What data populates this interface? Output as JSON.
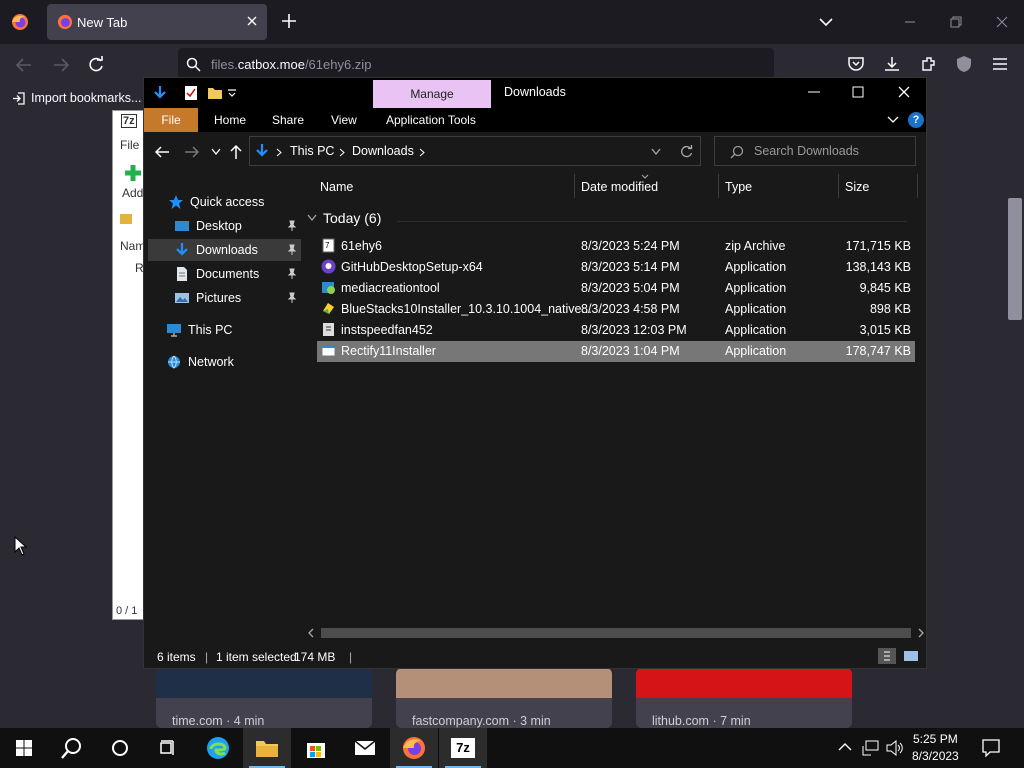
{
  "firefox": {
    "tab_title": "New Tab",
    "url_prefix": "files.",
    "url_domain": "catbox.moe",
    "url_path": "/61ehy6.zip",
    "bookmarks_import": "Import bookmarks...",
    "cards": [
      {
        "caption": "time.com · 4 min",
        "color": "#1f2f47"
      },
      {
        "caption": "fastcompany.com · 3 min",
        "color": "#b59078"
      },
      {
        "caption": "lithub.com · 7 min",
        "color": "#d51418"
      }
    ]
  },
  "sevenzip": {
    "logo": "7z",
    "menu_file": "File",
    "add": "Add",
    "col_name": "Nam",
    "row_fragment": "R",
    "status": "0 / 1"
  },
  "explorer": {
    "context_tab": "Manage",
    "title": "Downloads",
    "ribbon": {
      "file": "File",
      "home": "Home",
      "share": "Share",
      "view": "View",
      "app_tools": "Application Tools"
    },
    "help": "?",
    "breadcrumb": {
      "this_pc": "This PC",
      "downloads": "Downloads"
    },
    "search_placeholder": "Search Downloads",
    "nav": {
      "quick_access": "Quick access",
      "desktop": "Desktop",
      "downloads": "Downloads",
      "documents": "Documents",
      "pictures": "Pictures",
      "this_pc": "This PC",
      "network": "Network"
    },
    "columns": {
      "name": "Name",
      "date": "Date modified",
      "type": "Type",
      "size": "Size"
    },
    "group": "Today (6)",
    "files": [
      {
        "name": "61ehy6",
        "date": "8/3/2023 5:24 PM",
        "type": "zip Archive",
        "size": "171,715 KB",
        "icon": "zip-archive-icon",
        "selected": false
      },
      {
        "name": "GitHubDesktopSetup-x64",
        "date": "8/3/2023 5:14 PM",
        "type": "Application",
        "size": "138,143 KB",
        "icon": "github-icon",
        "selected": false
      },
      {
        "name": "mediacreationtool",
        "date": "8/3/2023 5:04 PM",
        "type": "Application",
        "size": "9,845 KB",
        "icon": "media-creation-icon",
        "selected": false
      },
      {
        "name": "BlueStacks10Installer_10.3.10.1004_native...",
        "date": "8/3/2023 4:58 PM",
        "type": "Application",
        "size": "898 KB",
        "icon": "bluestacks-icon",
        "selected": false
      },
      {
        "name": "instspeedfan452",
        "date": "8/3/2023 12:03 PM",
        "type": "Application",
        "size": "3,015 KB",
        "icon": "installer-icon",
        "selected": false
      },
      {
        "name": "Rectify11Installer",
        "date": "8/3/2023 1:04 PM",
        "type": "Application",
        "size": "178,747 KB",
        "icon": "application-icon",
        "selected": true
      }
    ],
    "status": {
      "count": "6 items",
      "selected": "1 item selected",
      "size": "174 MB"
    }
  },
  "taskbar": {
    "time": "5:25 PM",
    "date": "8/3/2023",
    "zip_label": "7z"
  }
}
